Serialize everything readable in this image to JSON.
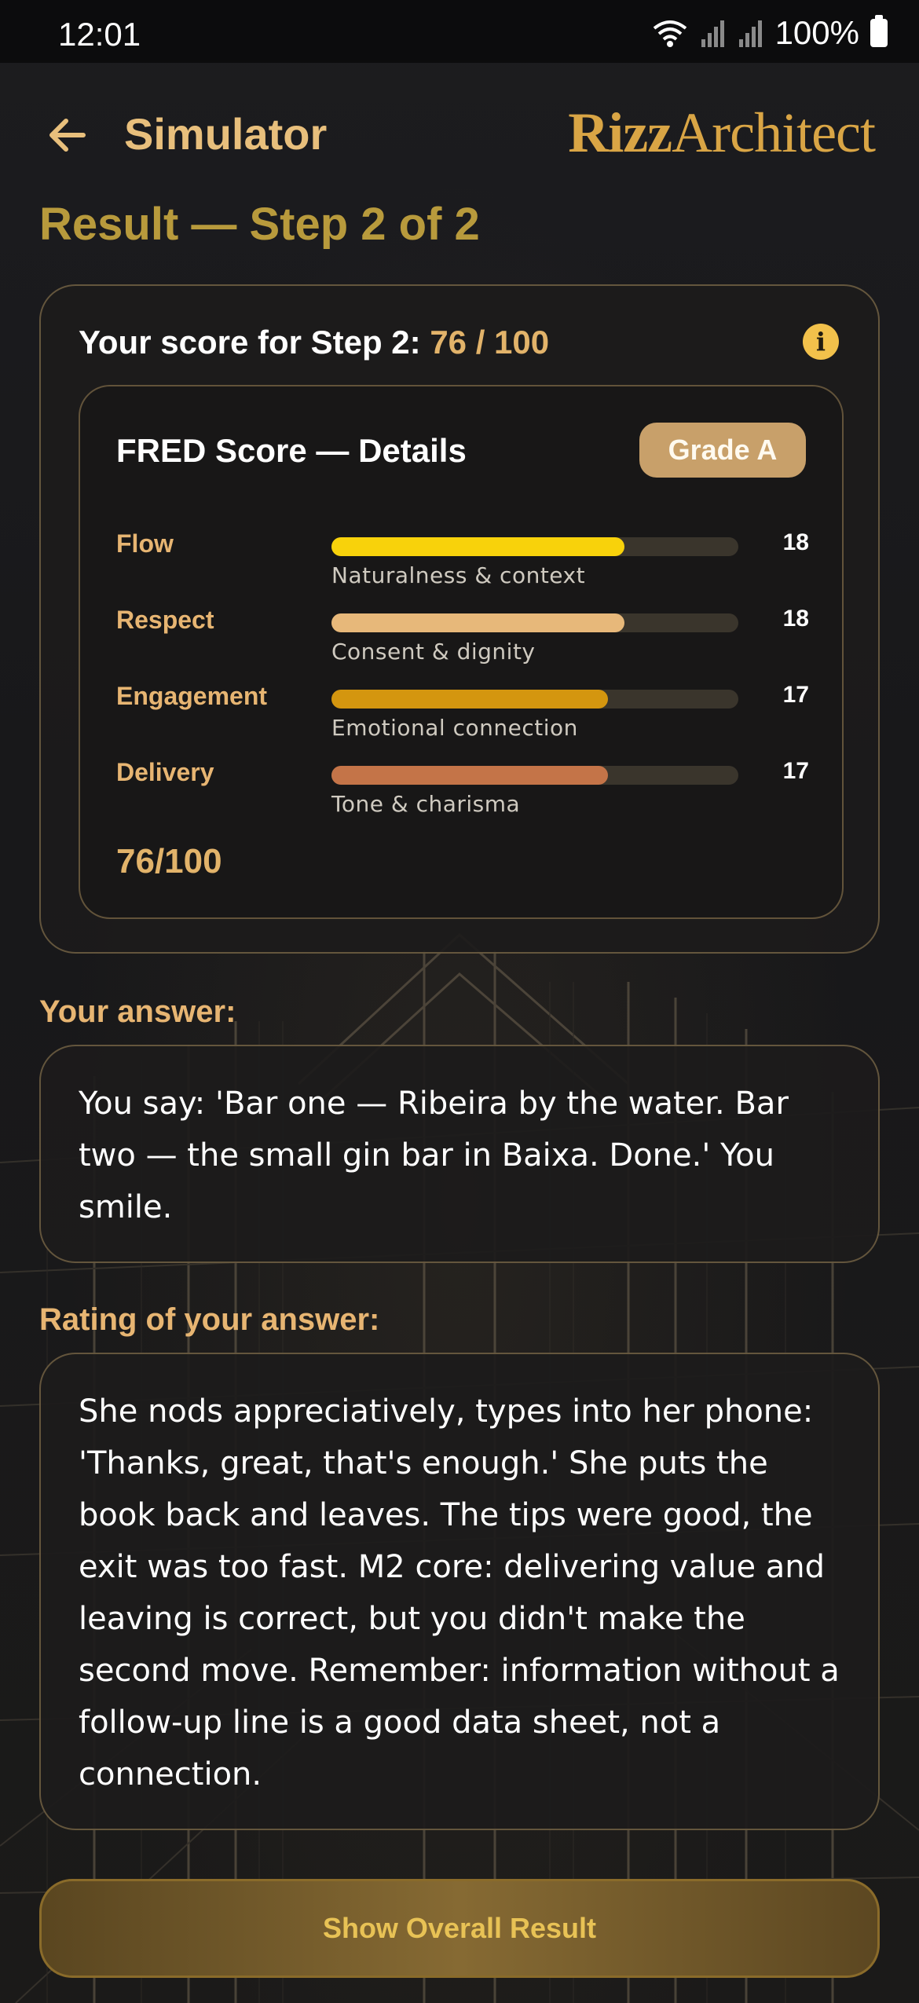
{
  "status_bar": {
    "time": "12:01",
    "battery": "100%"
  },
  "header": {
    "back_icon": "arrow-left-icon",
    "title": "Simulator",
    "logo_part1": "Rizz",
    "logo_part2": "Architect"
  },
  "page_heading": "Result — Step 2 of 2",
  "score": {
    "label": "Your score for Step 2: ",
    "value": "76 / 100",
    "info_icon": "info-icon"
  },
  "fred": {
    "title": "FRED Score — Details",
    "grade": "Grade A",
    "total": "76/100",
    "max_points": 25,
    "metrics": [
      {
        "label": "Flow",
        "description": "Naturalness & context",
        "value": 18,
        "display": "18",
        "color": "#f8d20b"
      },
      {
        "label": "Respect",
        "description": "Consent & dignity",
        "value": 18,
        "display": "18",
        "color": "#e7b87a"
      },
      {
        "label": "Engagement",
        "description": "Emotional connection",
        "value": 17,
        "display": "17",
        "color": "#d4960f"
      },
      {
        "label": "Delivery",
        "description": "Tone & charisma",
        "value": 17,
        "display": "17",
        "color": "#c47448"
      }
    ]
  },
  "answer": {
    "label": "Your answer:",
    "text": "You say: 'Bar one — Ribeira by the water. Bar two — the small gin bar in Baixa. Done.' You smile."
  },
  "rating": {
    "label": "Rating of your answer:",
    "text": "She nods appreciatively, types into her phone: 'Thanks, great, that's enough.' She puts the book back and leaves. The tips were good, the exit was too fast. M2 core: delivering value and leaving is correct, but you didn't make the second move. Remember: information without a follow-up line is a good data sheet, not a connection."
  },
  "actions": {
    "overall_button": "Show Overall Result"
  },
  "colors": {
    "accent": "#e2b36a",
    "heading": "#b89a3c",
    "button_text": "#e8c255"
  }
}
